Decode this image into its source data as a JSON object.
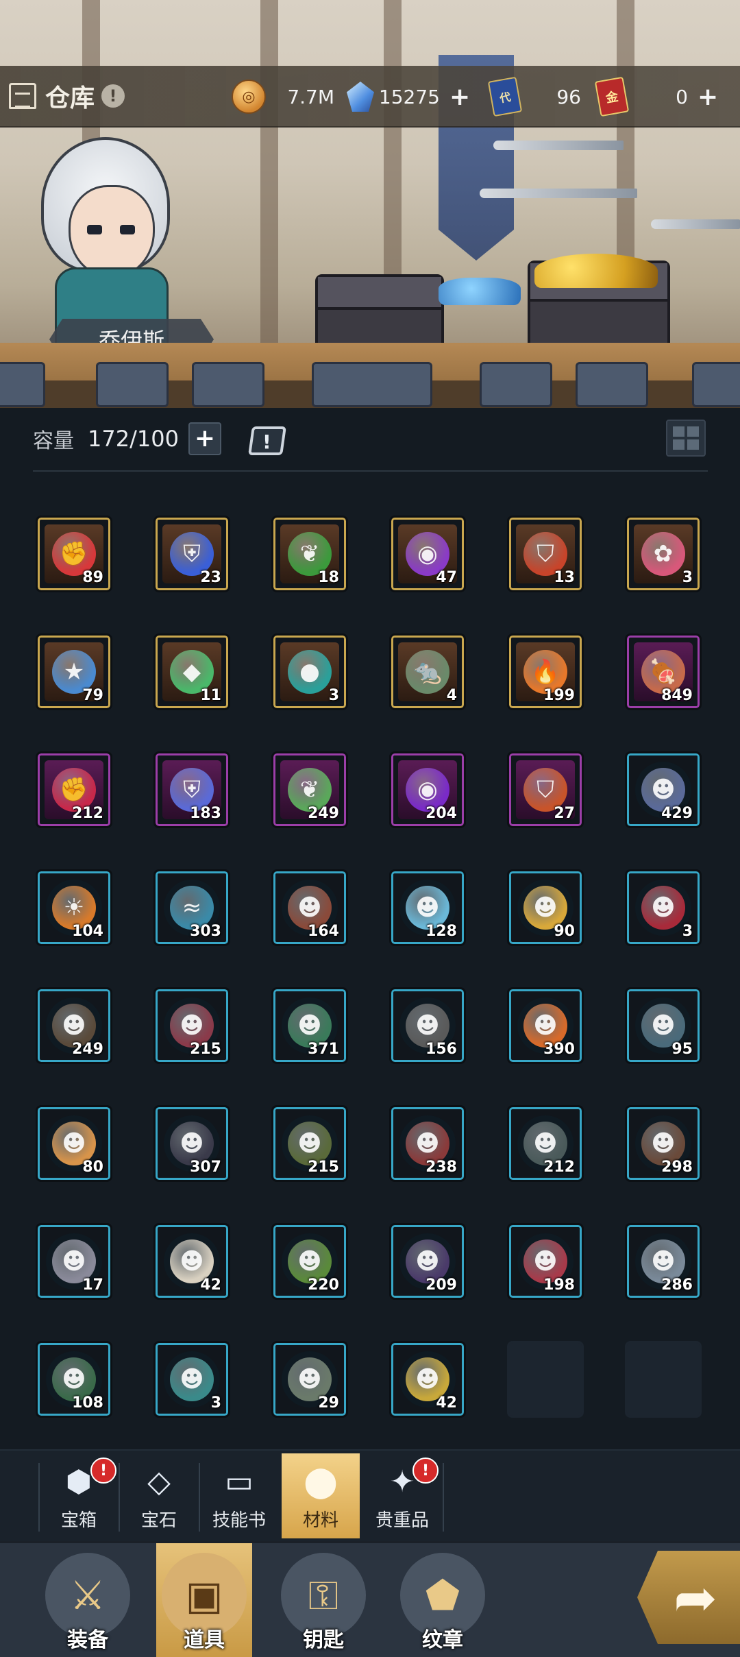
{
  "header": {
    "title": "仓库",
    "info_icon": "info-exclamation-icon",
    "character_name": "乔伊斯"
  },
  "resources": [
    {
      "icon": "gold-coin-icon",
      "value": "7.7M",
      "has_plus": false
    },
    {
      "icon": "blue-crystal-icon",
      "value": "15275",
      "has_plus": true
    },
    {
      "icon": "blue-ticket-icon",
      "glyph": "代",
      "value": "96",
      "has_plus": false
    },
    {
      "icon": "red-ticket-icon",
      "glyph": "金",
      "value": "0",
      "has_plus": true
    }
  ],
  "capacity": {
    "label": "容量",
    "value": "172/100",
    "plus": "+",
    "calendar_icon": "calendar-exclamation-icon",
    "calendar_mark": "!"
  },
  "colors": {
    "gold_frame": "#c9a74f",
    "purple_frame": "#9b3ea8",
    "cyan_frame": "#37a7c7",
    "active_tab": "#e6c27a",
    "notification": "#d62a2a"
  },
  "items": [
    {
      "frame": "gold",
      "icon": "red-fist-emblem",
      "color": "#d8383a",
      "glyph": "✊",
      "count": "89"
    },
    {
      "frame": "gold",
      "icon": "blue-shield-emblem",
      "color": "#3a5fd8",
      "glyph": "⛨",
      "count": "23"
    },
    {
      "frame": "gold",
      "icon": "green-sprout-emblem",
      "color": "#3c9a3c",
      "glyph": "❦",
      "count": "18"
    },
    {
      "frame": "gold",
      "icon": "purple-orb-emblem",
      "color": "#8a3ac8",
      "glyph": "◉",
      "count": "47"
    },
    {
      "frame": "gold",
      "icon": "red-banner-emblem",
      "color": "#c8442a",
      "glyph": "⛉",
      "count": "13"
    },
    {
      "frame": "gold",
      "icon": "pink-lotus-crystal",
      "color": "#d8587a",
      "glyph": "✿",
      "count": "3"
    },
    {
      "frame": "gold",
      "icon": "star-heart-crystal",
      "color": "#4a8ad0",
      "glyph": "★",
      "count": "79"
    },
    {
      "frame": "gold",
      "icon": "green-gem-shard",
      "color": "#4ab86a",
      "glyph": "◆",
      "count": "11"
    },
    {
      "frame": "gold",
      "icon": "teal-slime-orb",
      "color": "#2aa09a",
      "glyph": "●",
      "count": "3"
    },
    {
      "frame": "gold",
      "icon": "rat-portrait",
      "color": "#6a8a6a",
      "glyph": "🐀",
      "count": "4"
    },
    {
      "frame": "gold",
      "icon": "fire-essence",
      "color": "#e8782a",
      "glyph": "🔥",
      "count": "199"
    },
    {
      "frame": "purple",
      "icon": "meat-leg",
      "color": "#c86a4a",
      "glyph": "🍖",
      "count": "849"
    },
    {
      "frame": "purple",
      "icon": "red-fist-emblem",
      "color": "#c8284a",
      "glyph": "✊",
      "count": "212"
    },
    {
      "frame": "purple",
      "icon": "blue-shield-emblem",
      "color": "#5a6ad8",
      "glyph": "⛨",
      "count": "183"
    },
    {
      "frame": "purple",
      "icon": "green-sprout-emblem",
      "color": "#5aa85a",
      "glyph": "❦",
      "count": "249"
    },
    {
      "frame": "purple",
      "icon": "purple-orb-emblem",
      "color": "#7a2ac8",
      "glyph": "◉",
      "count": "204"
    },
    {
      "frame": "purple",
      "icon": "red-banner-emblem",
      "color": "#c8542a",
      "glyph": "⛉",
      "count": "27"
    },
    {
      "frame": "cyan",
      "icon": "hooded-goblin-portrait",
      "color": "#5a6a9a",
      "glyph": "☻",
      "count": "429"
    },
    {
      "frame": "cyan",
      "icon": "fire-spirit-portrait",
      "color": "#d87a2a",
      "glyph": "☀",
      "count": "104"
    },
    {
      "frame": "cyan",
      "icon": "water-serpent-portrait",
      "color": "#3a8aa8",
      "glyph": "≈",
      "count": "303"
    },
    {
      "frame": "cyan",
      "icon": "werewolf-portrait",
      "color": "#8a4a3a",
      "glyph": "☻",
      "count": "164"
    },
    {
      "frame": "cyan",
      "icon": "ice-spirit-portrait",
      "color": "#6ab8d8",
      "glyph": "☻",
      "count": "128"
    },
    {
      "frame": "cyan",
      "icon": "golden-priestess-portrait",
      "color": "#d8a83a",
      "glyph": "☻",
      "count": "90"
    },
    {
      "frame": "cyan",
      "icon": "red-dragon-portrait",
      "color": "#a82a3a",
      "glyph": "☻",
      "count": "3"
    },
    {
      "frame": "cyan",
      "icon": "tree-ent-portrait",
      "color": "#5a4a3a",
      "glyph": "☻",
      "count": "249"
    },
    {
      "frame": "cyan",
      "icon": "masked-demon-portrait",
      "color": "#8a3a4a",
      "glyph": "☻",
      "count": "215"
    },
    {
      "frame": "cyan",
      "icon": "green-medusa-portrait",
      "color": "#3a7a5a",
      "glyph": "☻",
      "count": "371"
    },
    {
      "frame": "cyan",
      "icon": "stone-golem-portrait",
      "color": "#5a5a5a",
      "glyph": "☻",
      "count": "156"
    },
    {
      "frame": "cyan",
      "icon": "flame-beast-portrait",
      "color": "#d86a2a",
      "glyph": "☻",
      "count": "390"
    },
    {
      "frame": "cyan",
      "icon": "horned-specter-portrait",
      "color": "#4a6a7a",
      "glyph": "☻",
      "count": "95"
    },
    {
      "frame": "cyan",
      "icon": "blonde-girl-portrait",
      "color": "#d8944a",
      "glyph": "☻",
      "count": "80"
    },
    {
      "frame": "cyan",
      "icon": "shadow-cat-portrait",
      "color": "#3a3a4a",
      "glyph": "☻",
      "count": "307"
    },
    {
      "frame": "cyan",
      "icon": "forest-owl-portrait",
      "color": "#5a6a3a",
      "glyph": "☻",
      "count": "215"
    },
    {
      "frame": "cyan",
      "icon": "armored-knight-portrait",
      "color": "#8a3a3a",
      "glyph": "☻",
      "count": "238"
    },
    {
      "frame": "cyan",
      "icon": "dark-elf-portrait",
      "color": "#4a5a5a",
      "glyph": "☻",
      "count": "212"
    },
    {
      "frame": "cyan",
      "icon": "bark-troll-portrait",
      "color": "#6a4a3a",
      "glyph": "☻",
      "count": "298"
    },
    {
      "frame": "cyan",
      "icon": "pale-ghost-portrait",
      "color": "#8a8a9a",
      "glyph": "☻",
      "count": "17"
    },
    {
      "frame": "cyan",
      "icon": "white-sage-portrait",
      "color": "#d8d0c0",
      "glyph": "☻",
      "count": "42"
    },
    {
      "frame": "cyan",
      "icon": "green-wyvern-portrait",
      "color": "#5a8a3a",
      "glyph": "☻",
      "count": "220"
    },
    {
      "frame": "cyan",
      "icon": "void-beast-portrait",
      "color": "#4a3a6a",
      "glyph": "☻",
      "count": "209"
    },
    {
      "frame": "cyan",
      "icon": "crimson-drake-portrait",
      "color": "#a83a4a",
      "glyph": "☻",
      "count": "198"
    },
    {
      "frame": "cyan",
      "icon": "white-wolf-portrait",
      "color": "#7a8a9a",
      "glyph": "☻",
      "count": "286"
    },
    {
      "frame": "cyan",
      "icon": "swamp-spirit-portrait",
      "color": "#3a6a4a",
      "glyph": "☻",
      "count": "108"
    },
    {
      "frame": "cyan",
      "icon": "teal-fox-portrait",
      "color": "#3a8a8a",
      "glyph": "☻",
      "count": "3"
    },
    {
      "frame": "cyan",
      "icon": "rat-portrait",
      "color": "#6a7a6a",
      "glyph": "☻",
      "count": "29"
    },
    {
      "frame": "cyan",
      "icon": "golden-helmet-portrait",
      "color": "#c8a83a",
      "glyph": "☻",
      "count": "42"
    },
    {
      "frame": "empty",
      "icon": "",
      "color": "",
      "glyph": "",
      "count": ""
    },
    {
      "frame": "empty",
      "icon": "",
      "color": "",
      "glyph": "",
      "count": ""
    }
  ],
  "categories": [
    {
      "id": "chest",
      "label": "宝箱",
      "icon": "chest-icon",
      "glyph": "⬢",
      "badge": "!",
      "active": false
    },
    {
      "id": "gem",
      "label": "宝石",
      "icon": "diamond-icon",
      "glyph": "◇",
      "badge": "",
      "active": false
    },
    {
      "id": "skillbook",
      "label": "技能书",
      "icon": "book-icon",
      "glyph": "▭",
      "badge": "",
      "active": false
    },
    {
      "id": "material",
      "label": "材料",
      "icon": "ore-icon",
      "glyph": "⬤",
      "badge": "",
      "active": true
    },
    {
      "id": "valuables",
      "label": "贵重品",
      "icon": "compass-star-icon",
      "glyph": "✦",
      "badge": "!",
      "active": false
    }
  ],
  "nav": [
    {
      "id": "equip",
      "label": "装备",
      "icon": "sword-armor-icon",
      "glyph": "⚔",
      "active": false
    },
    {
      "id": "items",
      "label": "道具",
      "icon": "chest-bag-icon",
      "glyph": "▣",
      "active": true
    },
    {
      "id": "keys",
      "label": "钥匙",
      "icon": "key-icon",
      "glyph": "⚿",
      "active": false
    },
    {
      "id": "badge",
      "label": "纹章",
      "icon": "emblem-icon",
      "glyph": "⬟",
      "active": false
    }
  ],
  "forward": {
    "icon": "forward-arrow-icon",
    "glyph": "➦"
  }
}
